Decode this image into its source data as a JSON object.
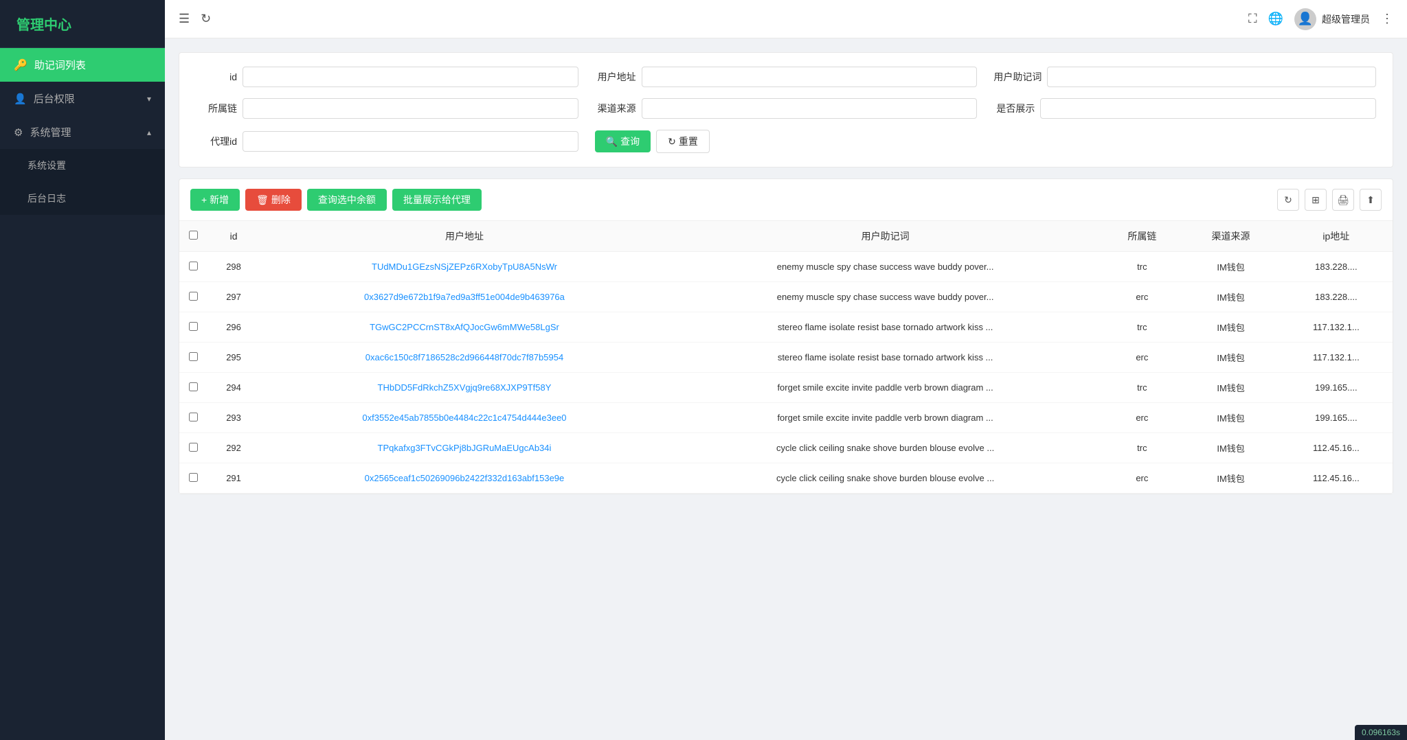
{
  "sidebar": {
    "logo": "管理中心",
    "items": [
      {
        "id": "mnemonic-list",
        "label": "助记词列表",
        "icon": "🔑",
        "active": true
      },
      {
        "id": "backend-permission",
        "label": "后台权限",
        "icon": "👤",
        "hasChildren": true,
        "expanded": false
      },
      {
        "id": "system-management",
        "label": "系统管理",
        "icon": "⚙",
        "hasChildren": true,
        "expanded": true
      }
    ],
    "sub_items": [
      {
        "id": "system-settings",
        "label": "系统设置"
      },
      {
        "id": "backend-log",
        "label": "后台日志"
      }
    ]
  },
  "header": {
    "menu_icon": "☰",
    "refresh_icon": "↻",
    "fullscreen_icon": "⛶",
    "globe_icon": "🌐",
    "more_icon": "⋮",
    "username": "超级管理员"
  },
  "filter": {
    "fields": [
      {
        "id": "id",
        "label": "id",
        "placeholder": ""
      },
      {
        "id": "user-address",
        "label": "用户地址",
        "placeholder": ""
      },
      {
        "id": "user-mnemonic",
        "label": "用户助记词",
        "placeholder": ""
      },
      {
        "id": "chain",
        "label": "所属链",
        "placeholder": ""
      },
      {
        "id": "channel",
        "label": "渠道来源",
        "placeholder": ""
      },
      {
        "id": "show",
        "label": "是否展示",
        "placeholder": ""
      },
      {
        "id": "agent-id",
        "label": "代理id",
        "placeholder": ""
      }
    ],
    "query_btn": "查询",
    "reset_btn": "重置",
    "query_icon": "🔍",
    "reset_icon": "↻"
  },
  "toolbar": {
    "add_btn": "+ 新增",
    "delete_btn": "删除",
    "query_balance_btn": "查询选中余额",
    "batch_show_btn": "批量展示给代理",
    "delete_icon": "🗑"
  },
  "table": {
    "columns": [
      "id",
      "用户地址",
      "用户助记词",
      "所属链",
      "渠道来源",
      "ip地址"
    ],
    "rows": [
      {
        "id": 298,
        "address": "TUdMDu1GEzsNSjZEPz6RXobyTpU8A5NsWr",
        "mnemonic": "enemy muscle spy chase success wave buddy pover...",
        "chain": "trc",
        "channel": "IM钱包",
        "ip": "183.228...."
      },
      {
        "id": 297,
        "address": "0x3627d9e672b1f9a7ed9a3ff51e004de9b463976a",
        "mnemonic": "enemy muscle spy chase success wave buddy pover...",
        "chain": "erc",
        "channel": "IM钱包",
        "ip": "183.228...."
      },
      {
        "id": 296,
        "address": "TGwGC2PCCrnST8xAfQJocGw6mMWe58LgSr",
        "mnemonic": "stereo flame isolate resist base tornado artwork kiss ...",
        "chain": "trc",
        "channel": "IM钱包",
        "ip": "117.132.1..."
      },
      {
        "id": 295,
        "address": "0xac6c150c8f7186528c2d966448f70dc7f87b5954",
        "mnemonic": "stereo flame isolate resist base tornado artwork kiss ...",
        "chain": "erc",
        "channel": "IM钱包",
        "ip": "117.132.1..."
      },
      {
        "id": 294,
        "address": "THbDD5FdRkchZ5XVgjq9re68XJXP9Tf58Y",
        "mnemonic": "forget smile excite invite paddle verb brown diagram ...",
        "chain": "trc",
        "channel": "IM钱包",
        "ip": "199.165...."
      },
      {
        "id": 293,
        "address": "0xf3552e45ab7855b0e4484c22c1c4754d444e3ee0",
        "mnemonic": "forget smile excite invite paddle verb brown diagram ...",
        "chain": "erc",
        "channel": "IM钱包",
        "ip": "199.165...."
      },
      {
        "id": 292,
        "address": "TPqkafxg3FTvCGkPj8bJGRuMaEUgcAb34i",
        "mnemonic": "cycle click ceiling snake shove burden blouse evolve ...",
        "chain": "trc",
        "channel": "IM钱包",
        "ip": "112.45.16..."
      },
      {
        "id": 291,
        "address": "0x2565ceaf1c50269096b2422f332d163abf153e9e",
        "mnemonic": "cycle click ceiling snake shove burden blouse evolve ...",
        "chain": "erc",
        "channel": "IM钱包",
        "ip": "112.45.16..."
      }
    ]
  },
  "bottom_badge": "0.096163s"
}
